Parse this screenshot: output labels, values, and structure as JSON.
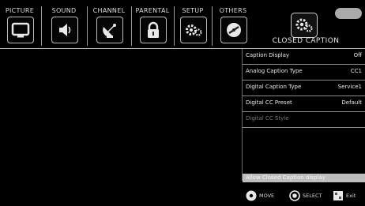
{
  "tabs": [
    {
      "label": "PICTURE",
      "icon": "tv-icon"
    },
    {
      "label": "SOUND",
      "icon": "speaker-icon"
    },
    {
      "label": "CHANNEL",
      "icon": "satellite-dish-icon"
    },
    {
      "label": "PARENTAL",
      "icon": "lock-icon"
    },
    {
      "label": "SETUP",
      "icon": "gears-icon"
    },
    {
      "label": "OTHERS",
      "icon": "disc-icon"
    }
  ],
  "section": {
    "title": "CLOSED CAPTION",
    "icon": "gears-icon"
  },
  "menu": {
    "items": [
      {
        "label": "Caption Display",
        "value": "Off"
      },
      {
        "label": "Analog Caption Type",
        "value": "CC1"
      },
      {
        "label": "Digital Caption Type",
        "value": "Service1"
      },
      {
        "label": "Digital CC Preset",
        "value": "Default"
      },
      {
        "label": "Digital CC Style",
        "value": ""
      }
    ]
  },
  "status": {
    "text": "Allow Closed Caption display"
  },
  "hints": {
    "move": "MOVE",
    "select": "SELECT",
    "exit": "Exit"
  }
}
